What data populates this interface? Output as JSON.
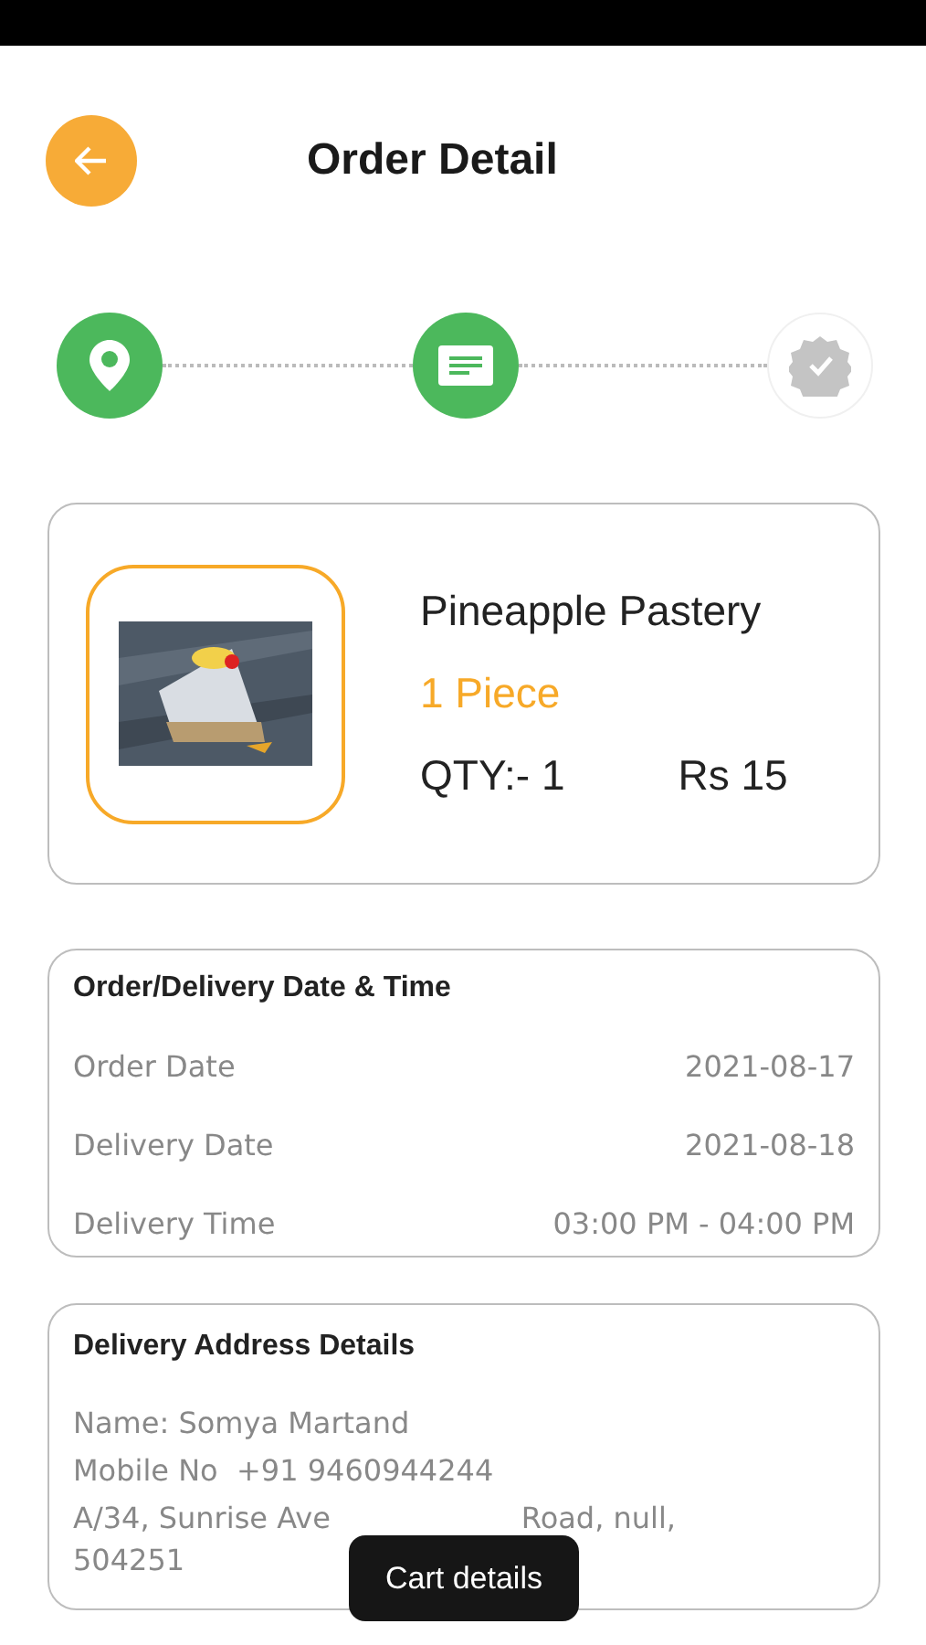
{
  "header": {
    "title": "Order Detail"
  },
  "steps": [
    {
      "kind": "location",
      "done": true
    },
    {
      "kind": "details",
      "done": true
    },
    {
      "kind": "confirmed",
      "done": false
    }
  ],
  "product": {
    "kind": "picture",
    "name": "Pineapple Pastery",
    "unit": "1 Piece",
    "qty": "QTY:- 1",
    "price": "Rs 15"
  },
  "schedule": {
    "title": "Order/Delivery Date & Time",
    "rows": [
      {
        "label": "Order Date",
        "value": "2021-08-17"
      },
      {
        "label": "Delivery Date",
        "value": "2021-08-18"
      },
      {
        "label": "Delivery Time",
        "value": "03:00 PM - 04:00 PM"
      }
    ]
  },
  "address": {
    "title": "Delivery Address Details",
    "name_label": "Name:",
    "name": "Somya Martand",
    "mobile_label": "Mobile No",
    "mobile": "+91 9460944244",
    "line_start": "A/34, Sunrise Ave",
    "line_end": "Road, null,",
    "line_2": "504251"
  },
  "toast": "Cart details"
}
